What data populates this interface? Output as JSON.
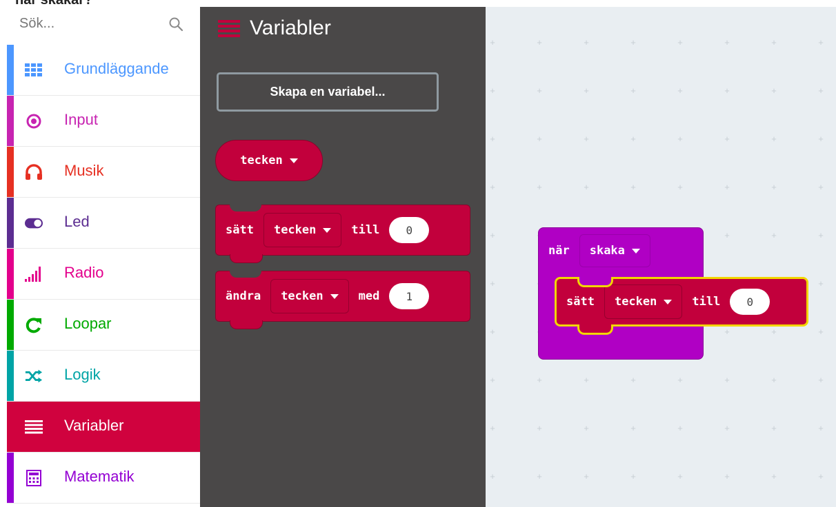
{
  "caption": "när skakar?",
  "search": {
    "placeholder": "Sök...",
    "icon": "search-icon"
  },
  "categories": [
    {
      "label": "Grundläggande",
      "color": "#4c97ff",
      "icon": "grid-icon"
    },
    {
      "label": "Input",
      "color": "#c724b1",
      "icon": "target-icon"
    },
    {
      "label": "Musik",
      "color": "#e63022",
      "icon": "headphones-icon"
    },
    {
      "label": "Led",
      "color": "#5c2d91",
      "icon": "toggle-icon"
    },
    {
      "label": "Radio",
      "color": "#e3008c",
      "icon": "signal-icon"
    },
    {
      "label": "Loopar",
      "color": "#00aa00",
      "icon": "refresh-icon"
    },
    {
      "label": "Logik",
      "color": "#00a4a6",
      "icon": "shuffle-icon"
    },
    {
      "label": "Variabler",
      "color": "#dc143c",
      "icon": "list-icon",
      "active": true
    },
    {
      "label": "Matematik",
      "color": "#9400d3",
      "icon": "calculator-icon"
    }
  ],
  "flyout": {
    "title": "Variabler",
    "create_button": "Skapa en variabel...",
    "variable_block": "tecken",
    "set_block": {
      "keyword": "sätt",
      "variable": "tecken",
      "to": "till",
      "value": "0"
    },
    "change_block": {
      "keyword": "ändra",
      "variable": "tecken",
      "by": "med",
      "value": "1"
    }
  },
  "workspace": {
    "event_block": {
      "keyword": "när",
      "gesture": "skaka"
    },
    "set_block": {
      "keyword": "sätt",
      "variable": "tecken",
      "to": "till",
      "value": "0"
    }
  },
  "colors": {
    "variables": "#c2003c",
    "input_block": "#b000c4",
    "flyout_bg": "#4a4848",
    "workspace_bg": "#e9eef2",
    "selection_outline": "#f2d600"
  }
}
